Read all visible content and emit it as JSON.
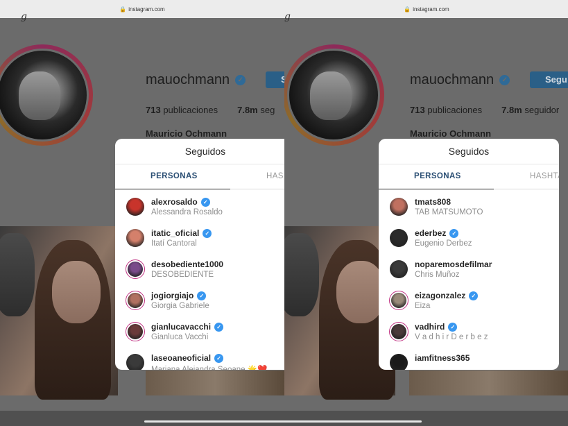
{
  "url": "instagram.com",
  "profile": {
    "username": "mauochmann",
    "follow_label": "Seguir",
    "follow_label_left_crop": "S",
    "posts_count": "713",
    "posts_label": "publicaciones",
    "followers_count": "7.8m",
    "followers_label_left": "seg",
    "followers_label_right": "seguidor",
    "full_name": "Mauricio Ochmann"
  },
  "modal": {
    "title": "Seguidos",
    "tab_people": "PERSONAS",
    "tab_hashtags_left": "HAS",
    "tab_hashtags_right": "HASHTAG"
  },
  "left_list": [
    {
      "username": "alexrosaldo",
      "name": "Alessandra Rosaldo",
      "verified": true,
      "ring": false,
      "color": "#c8342b"
    },
    {
      "username": "itatic_oficial",
      "name": "Itatí Cantoral",
      "verified": true,
      "ring": false,
      "color": "#d4806b"
    },
    {
      "username": "desobediente1000",
      "name": "DESOBEDIENTE",
      "verified": false,
      "ring": true,
      "color": "#7a4a8a"
    },
    {
      "username": "jogiorgiajo",
      "name": "Giorgia Gabriele",
      "verified": true,
      "ring": true,
      "color": "#b07060"
    },
    {
      "username": "gianlucavacchi",
      "name": "Gianluca Vacchi",
      "verified": true,
      "ring": true,
      "color": "#6a3a3a"
    },
    {
      "username": "laseoaneoficial",
      "name": "Mariana Alejandra Seoane 🌟❤️",
      "verified": true,
      "ring": false,
      "color": "#3a3a3a"
    }
  ],
  "right_list": [
    {
      "username": "tmats808",
      "name": "TAB MATSUMOTO",
      "verified": false,
      "ring": false,
      "color": "#c07060"
    },
    {
      "username": "ederbez",
      "name": "Eugenio Derbez",
      "verified": true,
      "ring": false,
      "color": "#2a2a2a"
    },
    {
      "username": "noparemosdefilmar",
      "name": "Chris Muñoz",
      "verified": false,
      "ring": false,
      "color": "#3a3a3a"
    },
    {
      "username": "eizagonzalez",
      "name": "Eiza",
      "verified": true,
      "ring": true,
      "color": "#9a8a7a"
    },
    {
      "username": "vadhird",
      "name": "V a d h i r D e r b e z",
      "verified": true,
      "ring": true,
      "color": "#4a3a3a"
    },
    {
      "username": "iamfitness365",
      "name": "",
      "verified": false,
      "ring": false,
      "color": "#1a1a1a"
    }
  ],
  "icons": {
    "lock": "lock-icon",
    "verified": "verified-badge-icon"
  }
}
